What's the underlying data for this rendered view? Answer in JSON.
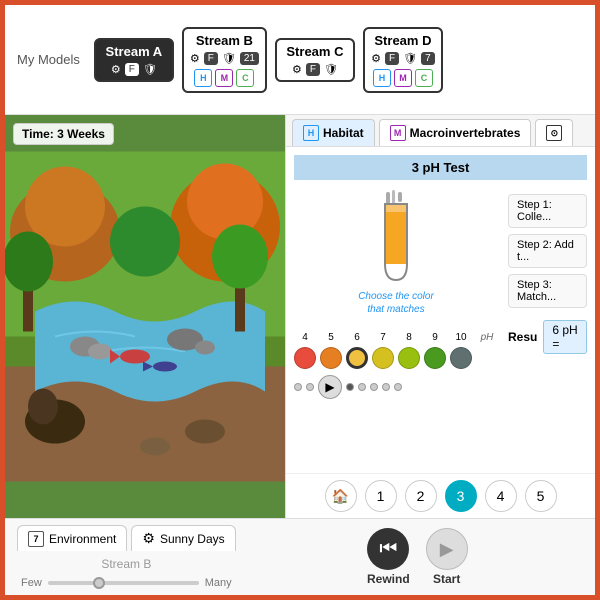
{
  "topBar": {
    "myModelsLabel": "My Models",
    "streams": [
      {
        "id": "stream-a",
        "title": "Stream A",
        "active": true,
        "icons": [
          "gear",
          "F",
          "shield"
        ],
        "badge": null,
        "bottomBadges": []
      },
      {
        "id": "stream-b",
        "title": "Stream B",
        "active": false,
        "icons": [
          "gear",
          "F",
          "shield"
        ],
        "badge": "21",
        "bottomBadges": [
          "H",
          "M",
          "C"
        ]
      },
      {
        "id": "stream-c",
        "title": "Stream C",
        "active": false,
        "icons": [
          "gear",
          "F",
          "shield"
        ],
        "badge": null,
        "bottomBadges": []
      },
      {
        "id": "stream-d",
        "title": "Stream D",
        "active": false,
        "icons": [
          "gear",
          "F",
          "shield"
        ],
        "badge": "7",
        "bottomBadges": [
          "H",
          "M",
          "C"
        ]
      }
    ]
  },
  "streamView": {
    "timeBadge": "Time: 3 Weeks"
  },
  "rightPanel": {
    "tabs": [
      {
        "id": "habitat",
        "icon": "H",
        "label": "Habitat",
        "active": true
      },
      {
        "id": "macroinvertebrates",
        "icon": "M",
        "label": "Macroinvertebrates",
        "active": false
      },
      {
        "id": "more",
        "icon": "...",
        "label": "",
        "active": false
      }
    ],
    "phTest": {
      "header": "3  pH Test",
      "chooseText": "Choose the color that matches",
      "phScale": {
        "numbers": [
          "4",
          "5",
          "6",
          "7",
          "8",
          "9",
          "10",
          "pH"
        ],
        "colors": [
          "#e74c3c",
          "#e67e22",
          "#f39c12",
          "#d4ac0d",
          "#a9c934",
          "#7fb334",
          "#6d8c5a",
          "#8e6a8a"
        ]
      },
      "selectedPh": "6",
      "steps": [
        {
          "label": "Step 1: Colle..."
        },
        {
          "label": "Step 2: Add t..."
        },
        {
          "label": "Step 3: Match..."
        }
      ],
      "result": {
        "label": "Resu",
        "value": "6 pH",
        "equals": "="
      }
    },
    "navButtons": [
      "🏠",
      "1",
      "2",
      "3",
      "4",
      "5"
    ],
    "activeNav": "3"
  },
  "bottomBar": {
    "environmentTab": "Environment",
    "environmentIcon": "7",
    "sunnyDaysTab": "Sunny Days",
    "streamLabel": "Stream B",
    "sliderMin": "Few",
    "sliderMax": "Many",
    "rewindLabel": "Rewind",
    "startLabel": "Start"
  }
}
